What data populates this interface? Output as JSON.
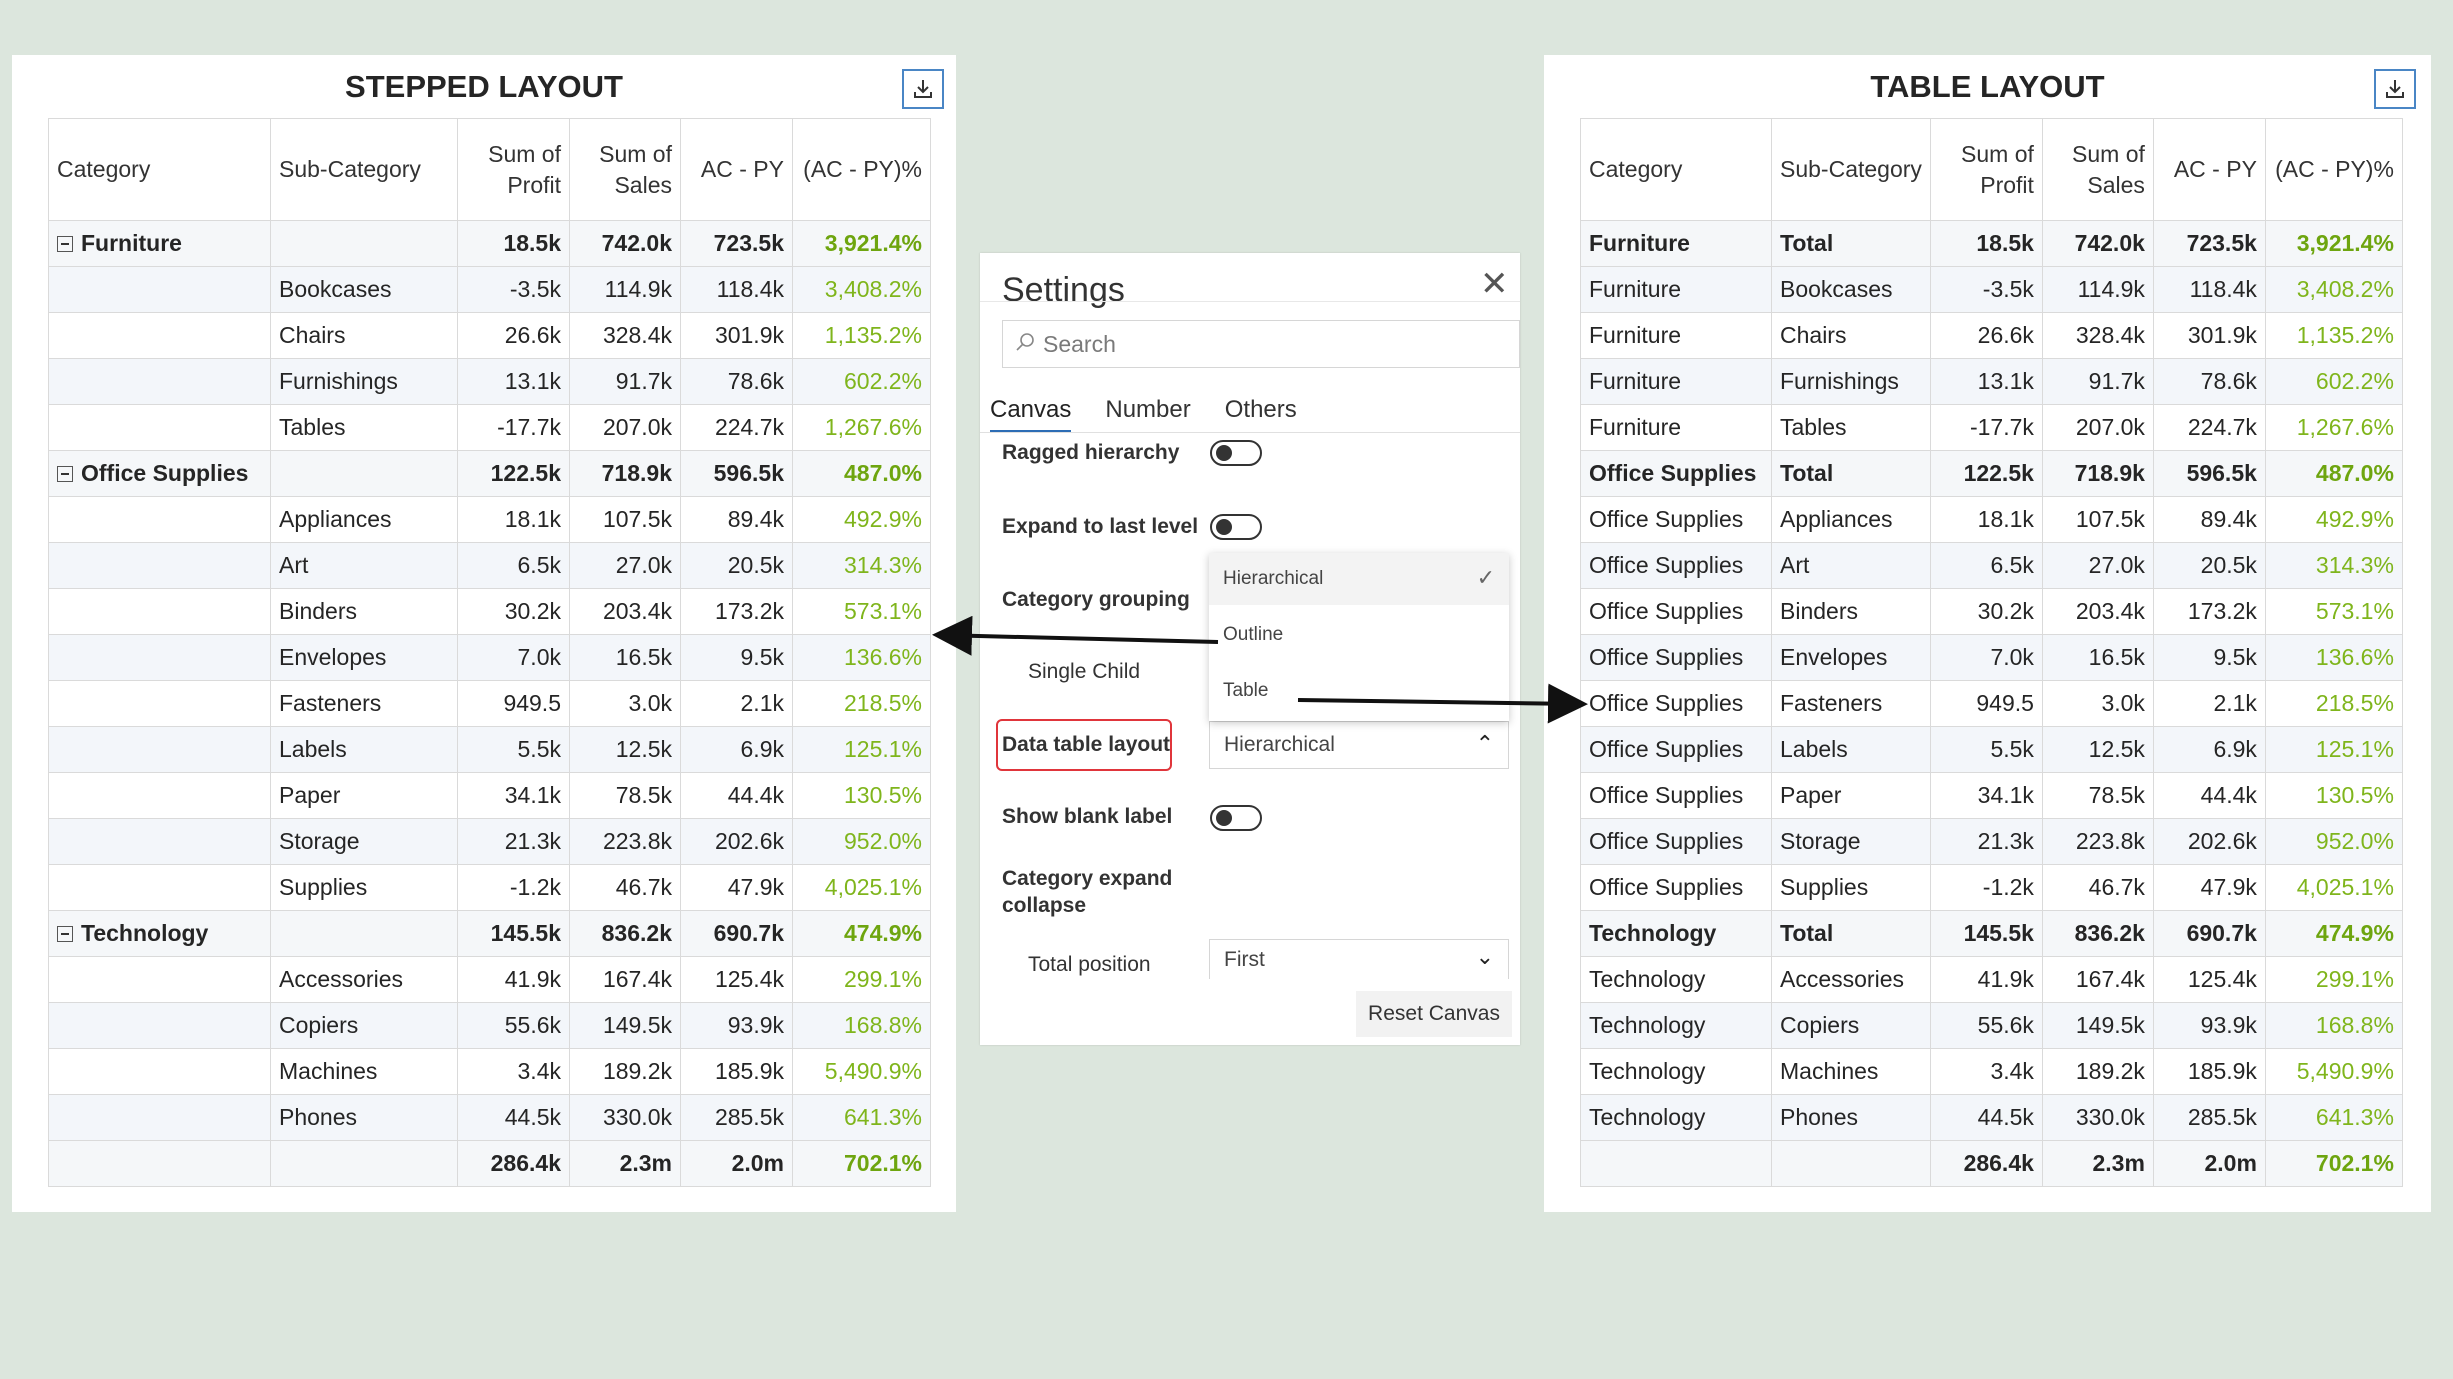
{
  "colors": {
    "background": "#dce6dd",
    "positive": "#7fb51c",
    "accent": "#2d6db5",
    "highlight": "#e0353b"
  },
  "headers": {
    "category": "Category",
    "subcategory": "Sub-Category",
    "profit": "Sum of Profit",
    "sales": "Sum of Sales",
    "acpy": "AC - PY",
    "acpy_pct": "(AC - PY)%"
  },
  "stepped": {
    "title": "STEPPED LAYOUT",
    "export_icon": "export-icon",
    "rows": [
      {
        "type": "group",
        "category": "Furniture",
        "sub": "",
        "profit": "18.5k",
        "sales": "742.0k",
        "acpy": "723.5k",
        "pct": "3,921.4%"
      },
      {
        "type": "item",
        "category": "",
        "sub": "Bookcases",
        "profit": "-3.5k",
        "sales": "114.9k",
        "acpy": "118.4k",
        "pct": "3,408.2%"
      },
      {
        "type": "item",
        "category": "",
        "sub": "Chairs",
        "profit": "26.6k",
        "sales": "328.4k",
        "acpy": "301.9k",
        "pct": "1,135.2%"
      },
      {
        "type": "item",
        "category": "",
        "sub": "Furnishings",
        "profit": "13.1k",
        "sales": "91.7k",
        "acpy": "78.6k",
        "pct": "602.2%"
      },
      {
        "type": "item",
        "category": "",
        "sub": "Tables",
        "profit": "-17.7k",
        "sales": "207.0k",
        "acpy": "224.7k",
        "pct": "1,267.6%"
      },
      {
        "type": "group",
        "category": "Office Supplies",
        "sub": "",
        "profit": "122.5k",
        "sales": "718.9k",
        "acpy": "596.5k",
        "pct": "487.0%"
      },
      {
        "type": "item",
        "category": "",
        "sub": "Appliances",
        "profit": "18.1k",
        "sales": "107.5k",
        "acpy": "89.4k",
        "pct": "492.9%"
      },
      {
        "type": "item",
        "category": "",
        "sub": "Art",
        "profit": "6.5k",
        "sales": "27.0k",
        "acpy": "20.5k",
        "pct": "314.3%"
      },
      {
        "type": "item",
        "category": "",
        "sub": "Binders",
        "profit": "30.2k",
        "sales": "203.4k",
        "acpy": "173.2k",
        "pct": "573.1%"
      },
      {
        "type": "item",
        "category": "",
        "sub": "Envelopes",
        "profit": "7.0k",
        "sales": "16.5k",
        "acpy": "9.5k",
        "pct": "136.6%"
      },
      {
        "type": "item",
        "category": "",
        "sub": "Fasteners",
        "profit": "949.5",
        "sales": "3.0k",
        "acpy": "2.1k",
        "pct": "218.5%"
      },
      {
        "type": "item",
        "category": "",
        "sub": "Labels",
        "profit": "5.5k",
        "sales": "12.5k",
        "acpy": "6.9k",
        "pct": "125.1%"
      },
      {
        "type": "item",
        "category": "",
        "sub": "Paper",
        "profit": "34.1k",
        "sales": "78.5k",
        "acpy": "44.4k",
        "pct": "130.5%"
      },
      {
        "type": "item",
        "category": "",
        "sub": "Storage",
        "profit": "21.3k",
        "sales": "223.8k",
        "acpy": "202.6k",
        "pct": "952.0%"
      },
      {
        "type": "item",
        "category": "",
        "sub": "Supplies",
        "profit": "-1.2k",
        "sales": "46.7k",
        "acpy": "47.9k",
        "pct": "4,025.1%"
      },
      {
        "type": "group",
        "category": "Technology",
        "sub": "",
        "profit": "145.5k",
        "sales": "836.2k",
        "acpy": "690.7k",
        "pct": "474.9%"
      },
      {
        "type": "item",
        "category": "",
        "sub": "Accessories",
        "profit": "41.9k",
        "sales": "167.4k",
        "acpy": "125.4k",
        "pct": "299.1%"
      },
      {
        "type": "item",
        "category": "",
        "sub": "Copiers",
        "profit": "55.6k",
        "sales": "149.5k",
        "acpy": "93.9k",
        "pct": "168.8%"
      },
      {
        "type": "item",
        "category": "",
        "sub": "Machines",
        "profit": "3.4k",
        "sales": "189.2k",
        "acpy": "185.9k",
        "pct": "5,490.9%"
      },
      {
        "type": "item",
        "category": "",
        "sub": "Phones",
        "profit": "44.5k",
        "sales": "330.0k",
        "acpy": "285.5k",
        "pct": "641.3%"
      },
      {
        "type": "total",
        "category": "",
        "sub": "",
        "profit": "286.4k",
        "sales": "2.3m",
        "acpy": "2.0m",
        "pct": "702.1%"
      }
    ]
  },
  "table": {
    "title": "TABLE LAYOUT",
    "export_icon": "export-icon",
    "rows": [
      {
        "type": "group",
        "category": "Furniture",
        "sub": "Total",
        "profit": "18.5k",
        "sales": "742.0k",
        "acpy": "723.5k",
        "pct": "3,921.4%"
      },
      {
        "type": "item",
        "category": "Furniture",
        "sub": "Bookcases",
        "profit": "-3.5k",
        "sales": "114.9k",
        "acpy": "118.4k",
        "pct": "3,408.2%"
      },
      {
        "type": "item",
        "category": "Furniture",
        "sub": "Chairs",
        "profit": "26.6k",
        "sales": "328.4k",
        "acpy": "301.9k",
        "pct": "1,135.2%"
      },
      {
        "type": "item",
        "category": "Furniture",
        "sub": "Furnishings",
        "profit": "13.1k",
        "sales": "91.7k",
        "acpy": "78.6k",
        "pct": "602.2%"
      },
      {
        "type": "item",
        "category": "Furniture",
        "sub": "Tables",
        "profit": "-17.7k",
        "sales": "207.0k",
        "acpy": "224.7k",
        "pct": "1,267.6%"
      },
      {
        "type": "group",
        "category": "Office Supplies",
        "sub": "Total",
        "profit": "122.5k",
        "sales": "718.9k",
        "acpy": "596.5k",
        "pct": "487.0%"
      },
      {
        "type": "item",
        "category": "Office Supplies",
        "sub": "Appliances",
        "profit": "18.1k",
        "sales": "107.5k",
        "acpy": "89.4k",
        "pct": "492.9%"
      },
      {
        "type": "item",
        "category": "Office Supplies",
        "sub": "Art",
        "profit": "6.5k",
        "sales": "27.0k",
        "acpy": "20.5k",
        "pct": "314.3%"
      },
      {
        "type": "item",
        "category": "Office Supplies",
        "sub": "Binders",
        "profit": "30.2k",
        "sales": "203.4k",
        "acpy": "173.2k",
        "pct": "573.1%"
      },
      {
        "type": "item",
        "category": "Office Supplies",
        "sub": "Envelopes",
        "profit": "7.0k",
        "sales": "16.5k",
        "acpy": "9.5k",
        "pct": "136.6%"
      },
      {
        "type": "item",
        "category": "Office Supplies",
        "sub": "Fasteners",
        "profit": "949.5",
        "sales": "3.0k",
        "acpy": "2.1k",
        "pct": "218.5%"
      },
      {
        "type": "item",
        "category": "Office Supplies",
        "sub": "Labels",
        "profit": "5.5k",
        "sales": "12.5k",
        "acpy": "6.9k",
        "pct": "125.1%"
      },
      {
        "type": "item",
        "category": "Office Supplies",
        "sub": "Paper",
        "profit": "34.1k",
        "sales": "78.5k",
        "acpy": "44.4k",
        "pct": "130.5%"
      },
      {
        "type": "item",
        "category": "Office Supplies",
        "sub": "Storage",
        "profit": "21.3k",
        "sales": "223.8k",
        "acpy": "202.6k",
        "pct": "952.0%"
      },
      {
        "type": "item",
        "category": "Office Supplies",
        "sub": "Supplies",
        "profit": "-1.2k",
        "sales": "46.7k",
        "acpy": "47.9k",
        "pct": "4,025.1%"
      },
      {
        "type": "group",
        "category": "Technology",
        "sub": "Total",
        "profit": "145.5k",
        "sales": "836.2k",
        "acpy": "690.7k",
        "pct": "474.9%"
      },
      {
        "type": "item",
        "category": "Technology",
        "sub": "Accessories",
        "profit": "41.9k",
        "sales": "167.4k",
        "acpy": "125.4k",
        "pct": "299.1%"
      },
      {
        "type": "item",
        "category": "Technology",
        "sub": "Copiers",
        "profit": "55.6k",
        "sales": "149.5k",
        "acpy": "93.9k",
        "pct": "168.8%"
      },
      {
        "type": "item",
        "category": "Technology",
        "sub": "Machines",
        "profit": "3.4k",
        "sales": "189.2k",
        "acpy": "185.9k",
        "pct": "5,490.9%"
      },
      {
        "type": "item",
        "category": "Technology",
        "sub": "Phones",
        "profit": "44.5k",
        "sales": "330.0k",
        "acpy": "285.5k",
        "pct": "641.3%"
      },
      {
        "type": "total",
        "category": "",
        "sub": "",
        "profit": "286.4k",
        "sales": "2.3m",
        "acpy": "2.0m",
        "pct": "702.1%"
      }
    ]
  },
  "settings": {
    "title": "Settings",
    "search_placeholder": "Search",
    "tabs": [
      "Canvas",
      "Number",
      "Others"
    ],
    "ragged_hierarchy": "Ragged hierarchy",
    "expand_last_level": "Expand to last level",
    "category_grouping": "Category grouping",
    "single_child": "Single Child",
    "data_table_layout": "Data table layout",
    "data_table_layout_value": "Hierarchical",
    "show_blank_label": "Show blank label",
    "category_expand_collapse": "Category expand collapse",
    "total_position": "Total position",
    "total_position_value": "First",
    "reset_button": "Reset Canvas",
    "dropdown_options": [
      "Hierarchical",
      "Outline",
      "Table"
    ],
    "dropdown_selected": "Hierarchical"
  }
}
